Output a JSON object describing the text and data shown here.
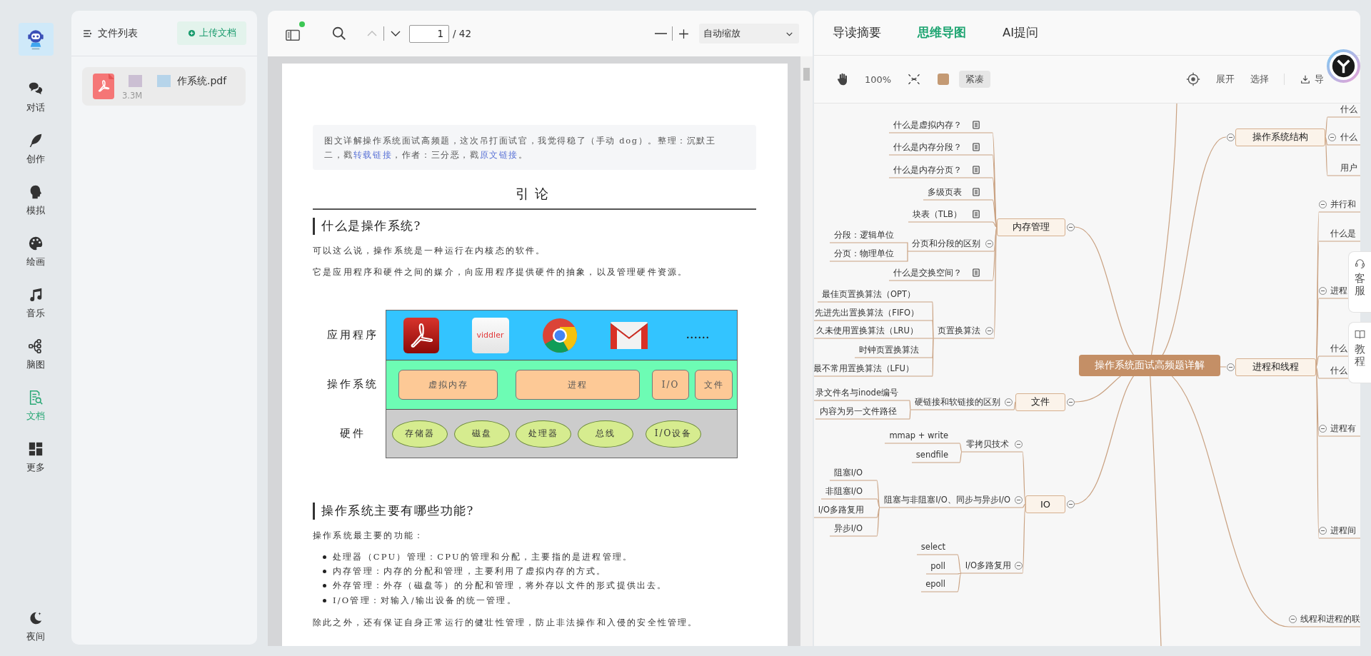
{
  "nav": {
    "items": [
      {
        "label": "对话",
        "kind": "chat",
        "selected": false
      },
      {
        "label": "创作",
        "kind": "feather",
        "selected": false
      },
      {
        "label": "模拟",
        "kind": "head",
        "selected": false
      },
      {
        "label": "绘画",
        "kind": "palette",
        "selected": false
      },
      {
        "label": "音乐",
        "kind": "music",
        "selected": false
      },
      {
        "label": "脑图",
        "kind": "mindmap",
        "selected": false
      },
      {
        "label": "文档",
        "kind": "document",
        "selected": true
      },
      {
        "label": "更多",
        "kind": "grid",
        "selected": false
      }
    ],
    "night_toggle": {
      "label": "夜间"
    }
  },
  "file_panel": {
    "title": "文件列表",
    "upload_button": "上传文档",
    "files": [
      {
        "name": "作系统.pdf",
        "size": "3.3M",
        "redacted": true,
        "selected": true
      }
    ]
  },
  "pdf_viewer": {
    "toolbar": {
      "sidebar_badge": true,
      "prev_disabled": true,
      "page": "1",
      "page_count": "/ 42",
      "zoom": "自动缩放"
    },
    "document": {
      "quote": [
        {
          "kind": "text",
          "text": "图文详解操作系统面试高频题，这次吊打面试官，我觉得稳了（手动 dog）。整理：沉默王二，戳"
        },
        {
          "kind": "link",
          "text": "转载链接"
        },
        {
          "kind": "text",
          "text": "，作者：三分恶，戳"
        },
        {
          "kind": "link",
          "text": "原文链接"
        },
        {
          "kind": "text",
          "text": "。"
        }
      ],
      "blocks": [
        {
          "kind": "title",
          "text": "引论"
        },
        {
          "kind": "heading",
          "text": "什么是操作系统?"
        },
        {
          "kind": "paragraph",
          "text": "可以这么说，操作系统是一种运行在内核态的软件。"
        },
        {
          "kind": "paragraph",
          "text": "它是应用程序和硬件之间的媒介，向应用程序提供硬件的抽象，以及管理硬件资源。"
        },
        {
          "kind": "diagram",
          "rows": [
            {
              "label": "应用程序",
              "kind": "apps",
              "items": [
                {
                  "kind": "pdf-reader"
                },
                {
                  "kind": "video",
                  "text": "viddler"
                },
                {
                  "kind": "browser"
                },
                {
                  "kind": "mail"
                },
                {
                  "kind": "more",
                  "text": "......"
                }
              ]
            },
            {
              "label": "操作系统",
              "kind": "modules",
              "items": [
                {
                  "text": "虚拟内存"
                },
                {
                  "text": "进程"
                },
                {
                  "text": "I/O"
                },
                {
                  "text": "文件"
                }
              ]
            },
            {
              "label": "硬件",
              "kind": "devices",
              "items": [
                {
                  "text": "存储器"
                },
                {
                  "text": "磁盘"
                },
                {
                  "text": "处理器"
                },
                {
                  "text": "总线"
                },
                {
                  "text": "I/O设备"
                }
              ]
            }
          ]
        },
        {
          "kind": "heading",
          "text": "操作系统主要有哪些功能?"
        },
        {
          "kind": "paragraph",
          "text": "操作系统最主要的功能："
        },
        {
          "kind": "list",
          "items": [
            "处理器（CPU）管理：CPU的管理和分配，主要指的是进程管理。",
            "内存管理：内存的分配和管理，主要利用了虚拟内存的方式。",
            "外存管理：外存（磁盘等）的分配和管理，将外存以文件的形式提供出去。",
            "I/O管理：对输入/输出设备的统一管理。"
          ]
        },
        {
          "kind": "paragraph",
          "text": "除此之外，还有保证自身正常运行的健壮性管理，防止非法操作和入侵的安全性管理。"
        }
      ]
    }
  },
  "mind_panel": {
    "tabs": [
      {
        "label": "导读摘要",
        "selected": false
      },
      {
        "label": "思维导图",
        "selected": true
      },
      {
        "label": "AI提问",
        "selected": false
      }
    ],
    "toolbar": {
      "zoom": "100%",
      "layout_button": "紧凑",
      "expand_button": "展开",
      "select_button": "选择",
      "export_button": "导"
    },
    "mind_map": {
      "root": {
        "text": "操作系统面试高频题详解",
        "children": [
          {
            "text": "内存管理",
            "expanded": true,
            "children": [
              {
                "text": "什么是虚拟内存？",
                "note": true
              },
              {
                "text": "什么是内存分段？",
                "note": true
              },
              {
                "text": "什么是内存分页？",
                "note": true
              },
              {
                "text": "多级页表",
                "note": true
              },
              {
                "text": "块表（TLB）",
                "note": true
              },
              {
                "text": "分页和分段的区别",
                "expanded": true,
                "children": [
                  {
                    "text": "分段：逻辑单位"
                  },
                  {
                    "text": "分页：物理单位"
                  }
                ]
              },
              {
                "text": "什么是交换空间？",
                "note": true
              },
              {
                "text": "页置换算法",
                "expanded": true,
                "children": [
                  {
                    "text": "最佳页置换算法（OPT）"
                  },
                  {
                    "text": "先进先出置换算法（FIFO）"
                  },
                  {
                    "text": "久未使用置换算法（LRU）"
                  },
                  {
                    "text": "时钟页置换算法"
                  },
                  {
                    "text": "最不常用置换算法（LFU）"
                  }
                ]
              }
            ]
          },
          {
            "text": "文件",
            "expanded": true,
            "children": [
              {
                "text": "硬链接和软链接的区别",
                "expanded": true,
                "children": [
                  {
                    "text": "录文件名与inode编号"
                  },
                  {
                    "text": "内容为另一文件路径"
                  }
                ]
              }
            ]
          },
          {
            "text": "IO",
            "expanded": true,
            "children": [
              {
                "text": "零拷贝技术",
                "expanded": true,
                "children": [
                  {
                    "text": "mmap + write"
                  },
                  {
                    "text": "sendfile"
                  }
                ]
              },
              {
                "text": "阻塞与非阻塞I/O、同步与异步I/O",
                "expanded": true,
                "children": [
                  {
                    "text": "阻塞I/O"
                  },
                  {
                    "text": "非阻塞I/O"
                  },
                  {
                    "text": "I/O多路复用"
                  },
                  {
                    "text": "异步I/O"
                  }
                ]
              },
              {
                "text": "I/O多路复用",
                "expanded": true,
                "children": [
                  {
                    "text": "select"
                  },
                  {
                    "text": "poll"
                  },
                  {
                    "text": "epoll"
                  }
                ]
              }
            ]
          },
          {
            "text": "操作系统结构",
            "expanded": true,
            "children": [
              {
                "text": "什么"
              },
              {
                "text": "什么",
                "expanded": true
              },
              {
                "text": "用户"
              }
            ]
          },
          {
            "text": "进程和线程",
            "expanded": true,
            "children": [
              {
                "text": "并行和",
                "expanded": true
              },
              {
                "text": "什么是"
              },
              {
                "text": "进程",
                "expanded": true
              },
              {
                "text": "什么"
              },
              {
                "text": "什么"
              },
              {
                "text": "进程有",
                "expanded": true
              },
              {
                "text": "进程间",
                "expanded": true
              }
            ]
          },
          {
            "text": "线程和进程的联",
            "expanded": true
          }
        ]
      }
    }
  },
  "side_buttons": [
    {
      "label": "客服",
      "kind": "service"
    },
    {
      "label": "教程",
      "kind": "guide"
    }
  ]
}
